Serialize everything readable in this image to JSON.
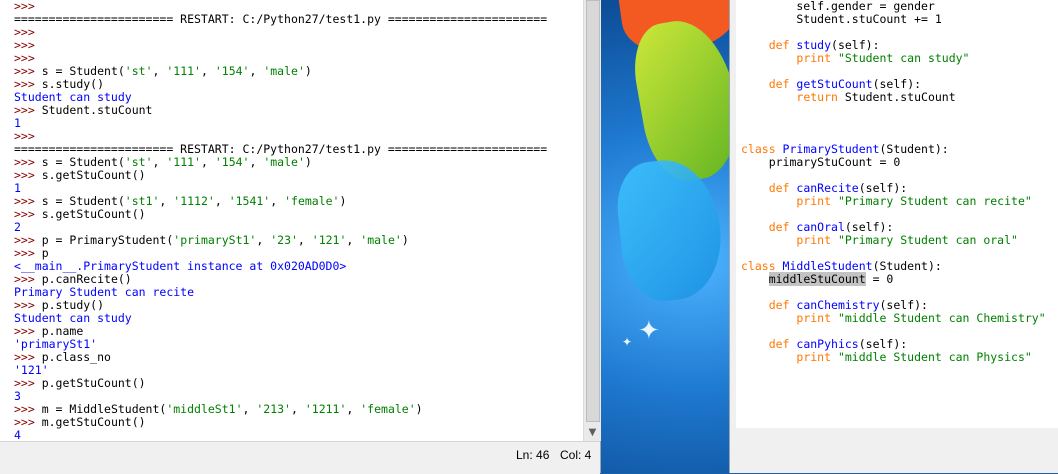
{
  "shell": {
    "lines": [
      [
        [
          "prompt",
          ">>> "
        ]
      ],
      [
        [
          "restart",
          "======================= RESTART: C:/Python27/test1.py ======================="
        ]
      ],
      [
        [
          "prompt",
          ">>> "
        ]
      ],
      [
        [
          "prompt",
          ">>> "
        ]
      ],
      [
        [
          "prompt",
          ">>> "
        ]
      ],
      [
        [
          "prompt",
          ">>> "
        ],
        [
          "code",
          "s = Student("
        ],
        [
          "str",
          "'st'"
        ],
        [
          "code",
          ", "
        ],
        [
          "str",
          "'111'"
        ],
        [
          "code",
          ", "
        ],
        [
          "str",
          "'154'"
        ],
        [
          "code",
          ", "
        ],
        [
          "str",
          "'male'"
        ],
        [
          "code",
          ")"
        ]
      ],
      [
        [
          "prompt",
          ">>> "
        ],
        [
          "code",
          "s.study()"
        ]
      ],
      [
        [
          "out",
          "Student can study"
        ]
      ],
      [
        [
          "prompt",
          ">>> "
        ],
        [
          "code",
          "Student.stuCount"
        ]
      ],
      [
        [
          "out",
          "1"
        ]
      ],
      [
        [
          "prompt",
          ">>> "
        ]
      ],
      [
        [
          "restart",
          "======================= RESTART: C:/Python27/test1.py ======================="
        ]
      ],
      [
        [
          "prompt",
          ">>> "
        ],
        [
          "code",
          "s = Student("
        ],
        [
          "str",
          "'st'"
        ],
        [
          "code",
          ", "
        ],
        [
          "str",
          "'111'"
        ],
        [
          "code",
          ", "
        ],
        [
          "str",
          "'154'"
        ],
        [
          "code",
          ", "
        ],
        [
          "str",
          "'male'"
        ],
        [
          "code",
          ")"
        ]
      ],
      [
        [
          "prompt",
          ">>> "
        ],
        [
          "code",
          "s.getStuCount()"
        ]
      ],
      [
        [
          "out",
          "1"
        ]
      ],
      [
        [
          "prompt",
          ">>> "
        ],
        [
          "code",
          "s = Student("
        ],
        [
          "str",
          "'st1'"
        ],
        [
          "code",
          ", "
        ],
        [
          "str",
          "'1112'"
        ],
        [
          "code",
          ", "
        ],
        [
          "str",
          "'1541'"
        ],
        [
          "code",
          ", "
        ],
        [
          "str",
          "'female'"
        ],
        [
          "code",
          ")"
        ]
      ],
      [
        [
          "prompt",
          ">>> "
        ],
        [
          "code",
          "s.getStuCount()"
        ]
      ],
      [
        [
          "out",
          "2"
        ]
      ],
      [
        [
          "prompt",
          ">>> "
        ],
        [
          "code",
          "p = PrimaryStudent("
        ],
        [
          "str",
          "'primarySt1'"
        ],
        [
          "code",
          ", "
        ],
        [
          "str",
          "'23'"
        ],
        [
          "code",
          ", "
        ],
        [
          "str",
          "'121'"
        ],
        [
          "code",
          ", "
        ],
        [
          "str",
          "'male'"
        ],
        [
          "code",
          ")"
        ]
      ],
      [
        [
          "prompt",
          ">>> "
        ],
        [
          "code",
          "p"
        ]
      ],
      [
        [
          "out",
          "<__main__.PrimaryStudent instance at 0x020AD0D0>"
        ]
      ],
      [
        [
          "prompt",
          ">>> "
        ],
        [
          "code",
          "p.canRecite()"
        ]
      ],
      [
        [
          "out",
          "Primary Student can recite"
        ]
      ],
      [
        [
          "prompt",
          ">>> "
        ],
        [
          "code",
          "p.study()"
        ]
      ],
      [
        [
          "out",
          "Student can study"
        ]
      ],
      [
        [
          "prompt",
          ">>> "
        ],
        [
          "code",
          "p.name"
        ]
      ],
      [
        [
          "out",
          "'primarySt1'"
        ]
      ],
      [
        [
          "prompt",
          ">>> "
        ],
        [
          "code",
          "p.class_no"
        ]
      ],
      [
        [
          "out",
          "'121'"
        ]
      ],
      [
        [
          "prompt",
          ">>> "
        ],
        [
          "code",
          "p.getStuCount()"
        ]
      ],
      [
        [
          "out",
          "3"
        ]
      ],
      [
        [
          "prompt",
          ">>> "
        ],
        [
          "code",
          "m = MiddleStudent("
        ],
        [
          "str",
          "'middleSt1'"
        ],
        [
          "code",
          ", "
        ],
        [
          "str",
          "'213'"
        ],
        [
          "code",
          ", "
        ],
        [
          "str",
          "'1211'"
        ],
        [
          "code",
          ", "
        ],
        [
          "str",
          "'female'"
        ],
        [
          "code",
          ")"
        ]
      ],
      [
        [
          "prompt",
          ">>> "
        ],
        [
          "code",
          "m.getStuCount()"
        ]
      ],
      [
        [
          "out",
          "4"
        ]
      ],
      [
        [
          "prompt",
          ">>> "
        ]
      ]
    ]
  },
  "status": {
    "ln": "Ln: 46",
    "col": "Col: 4"
  },
  "editor": {
    "lines": [
      [
        [
          "code",
          "        self.gender = gender"
        ]
      ],
      [
        [
          "code",
          "        Student.stuCount += 1"
        ]
      ],
      [
        [
          "code",
          ""
        ]
      ],
      [
        [
          "code",
          "    "
        ],
        [
          "kw",
          "def "
        ],
        [
          "def",
          "study"
        ],
        [
          "code",
          "(self):"
        ]
      ],
      [
        [
          "code",
          "        "
        ],
        [
          "kw",
          "print "
        ],
        [
          "str",
          "\"Student can study\""
        ]
      ],
      [
        [
          "code",
          ""
        ]
      ],
      [
        [
          "code",
          "    "
        ],
        [
          "kw",
          "def "
        ],
        [
          "def",
          "getStuCount"
        ],
        [
          "code",
          "(self):"
        ]
      ],
      [
        [
          "code",
          "        "
        ],
        [
          "kw",
          "return "
        ],
        [
          "code",
          "Student.stuCount"
        ]
      ],
      [
        [
          "code",
          ""
        ]
      ],
      [
        [
          "code",
          ""
        ]
      ],
      [
        [
          "code",
          ""
        ]
      ],
      [
        [
          "kw",
          "class "
        ],
        [
          "def",
          "PrimaryStudent"
        ],
        [
          "code",
          "(Student):"
        ]
      ],
      [
        [
          "code",
          "    primaryStuCount = 0"
        ]
      ],
      [
        [
          "code",
          ""
        ]
      ],
      [
        [
          "code",
          "    "
        ],
        [
          "kw",
          "def "
        ],
        [
          "def",
          "canRecite"
        ],
        [
          "code",
          "(self):"
        ]
      ],
      [
        [
          "code",
          "        "
        ],
        [
          "kw",
          "print "
        ],
        [
          "str",
          "\"Primary Student can recite\""
        ]
      ],
      [
        [
          "code",
          ""
        ]
      ],
      [
        [
          "code",
          "    "
        ],
        [
          "kw",
          "def "
        ],
        [
          "def",
          "canOral"
        ],
        [
          "code",
          "(self):"
        ]
      ],
      [
        [
          "code",
          "        "
        ],
        [
          "kw",
          "print "
        ],
        [
          "str",
          "\"Primary Student can oral\""
        ]
      ],
      [
        [
          "code",
          ""
        ]
      ],
      [
        [
          "kw",
          "class "
        ],
        [
          "def",
          "MiddleStudent"
        ],
        [
          "code",
          "(Student):"
        ]
      ],
      [
        [
          "code",
          "    "
        ],
        [
          "sel",
          "middleStuCount"
        ],
        [
          "code",
          " = 0"
        ]
      ],
      [
        [
          "code",
          ""
        ]
      ],
      [
        [
          "code",
          "    "
        ],
        [
          "kw",
          "def "
        ],
        [
          "def",
          "canChemistry"
        ],
        [
          "code",
          "(self):"
        ]
      ],
      [
        [
          "code",
          "        "
        ],
        [
          "kw",
          "print "
        ],
        [
          "str",
          "\"middle Student can Chemistry\""
        ]
      ],
      [
        [
          "code",
          ""
        ]
      ],
      [
        [
          "code",
          "    "
        ],
        [
          "kw",
          "def "
        ],
        [
          "def",
          "canPyhics"
        ],
        [
          "code",
          "(self):"
        ]
      ],
      [
        [
          "code",
          "        "
        ],
        [
          "kw",
          "print "
        ],
        [
          "str",
          "\"middle Student can Physics\""
        ]
      ]
    ]
  }
}
